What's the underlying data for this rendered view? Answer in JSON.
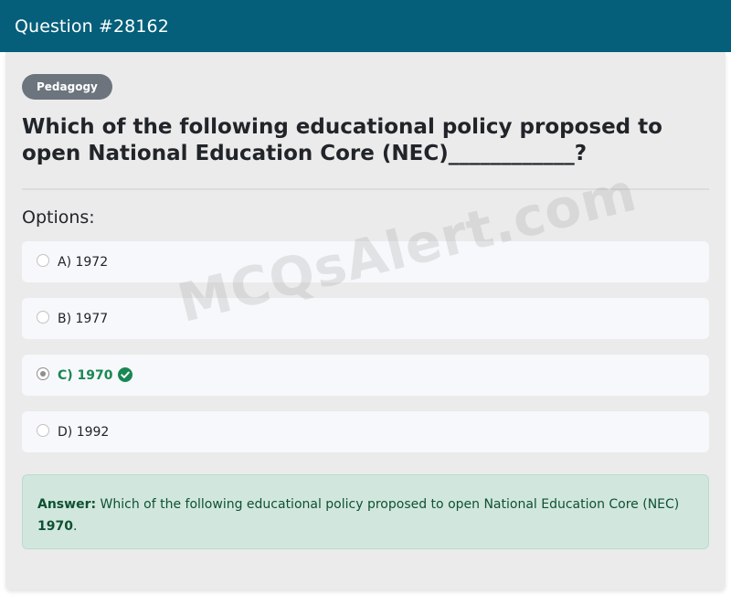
{
  "header": {
    "title": "Question #28162"
  },
  "badge": {
    "label": "Pedagogy"
  },
  "question": {
    "text": "Which of the following educational policy proposed to open National Education Core (NEC)____________?"
  },
  "options_label": "Options:",
  "options": [
    {
      "label": "A) 1972",
      "selected": false,
      "correct": false
    },
    {
      "label": "B) 1977",
      "selected": false,
      "correct": false
    },
    {
      "label": "C) 1970",
      "selected": true,
      "correct": true,
      "icon": "check-circle-icon"
    },
    {
      "label": "D) 1992",
      "selected": false,
      "correct": false
    }
  ],
  "answer": {
    "prefix": "Answer:",
    "text": " Which of the following educational policy proposed to open National Education Core (NEC) ",
    "value": "1970",
    "suffix": "."
  },
  "watermark": "MCQsAlert.com",
  "colors": {
    "header": "#055f7a",
    "badge": "#6c757d",
    "correct": "#198754",
    "answer_bg": "#d1e7dd"
  }
}
